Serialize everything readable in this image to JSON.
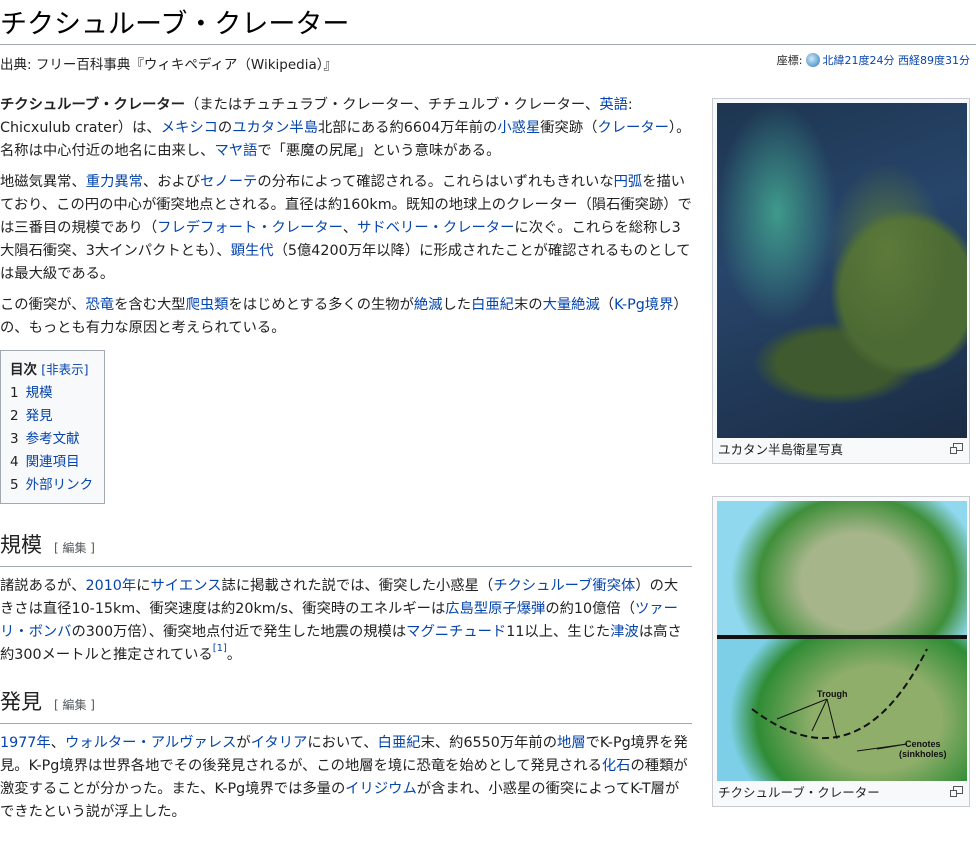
{
  "title": "チクシュルーブ・クレーター",
  "subtitle": "出典: フリー百科事典『ウィキペディア（Wikipedia）』",
  "coord": {
    "label": "座標:",
    "value": "北緯21度24分 西経89度31分"
  },
  "intro": [
    [
      [
        "チクシュルーブ・クレーター",
        "b"
      ],
      [
        "（またはチュチュラブ・クレーター、チチュルブ・クレーター、",
        0
      ],
      [
        "英語",
        1
      ],
      [
        ": Chicxulub crater）は、",
        0
      ],
      [
        "メキシコ",
        1
      ],
      [
        "の",
        0
      ],
      [
        "ユカタン半島",
        1
      ],
      [
        "北部にある約6604万年前の",
        0
      ],
      [
        "小惑星",
        1
      ],
      [
        "衝突跡（",
        0
      ],
      [
        "クレーター",
        1
      ],
      [
        "）。名称は中心付近の地名に由来し、",
        0
      ],
      [
        "マヤ語",
        1
      ],
      [
        "で「悪魔の尻尾」という意味がある。",
        0
      ]
    ],
    [
      [
        "地磁気異常、",
        0
      ],
      [
        "重力異常",
        1
      ],
      [
        "、および",
        0
      ],
      [
        "セノーテ",
        1
      ],
      [
        "の分布によって確認される。これらはいずれもきれいな",
        0
      ],
      [
        "円弧",
        1
      ],
      [
        "を描いており、この円の中心が衝突地点とされる。直径は約160km。既知の地球上のクレーター（隕石衝突跡）では三番目の規模であり（",
        0
      ],
      [
        "フレデフォート・クレーター",
        1
      ],
      [
        "、",
        0
      ],
      [
        "サドベリー・クレーター",
        1
      ],
      [
        "に次ぐ。これらを総称し3大隕石衝突、3大インパクトとも）、",
        0
      ],
      [
        "顕生代",
        1
      ],
      [
        "（5億4200万年以降）に形成されたことが確認されるものとしては最大級である。",
        0
      ]
    ],
    [
      [
        "この衝突が、",
        0
      ],
      [
        "恐竜",
        1
      ],
      [
        "を含む大型",
        0
      ],
      [
        "爬虫類",
        1
      ],
      [
        "をはじめとする多くの生物が",
        0
      ],
      [
        "絶滅",
        1
      ],
      [
        "した",
        0
      ],
      [
        "白亜紀",
        1
      ],
      [
        "末の",
        0
      ],
      [
        "大量絶滅",
        1
      ],
      [
        "（",
        0
      ],
      [
        "K-Pg境界",
        1
      ],
      [
        "）の、もっとも有力な原因と考えられている。",
        0
      ]
    ]
  ],
  "toc": {
    "title": "目次",
    "hide": "[非表示]",
    "items": [
      {
        "num": "1",
        "label": "規模"
      },
      {
        "num": "2",
        "label": "発見"
      },
      {
        "num": "3",
        "label": "参考文献"
      },
      {
        "num": "4",
        "label": "関連項目"
      },
      {
        "num": "5",
        "label": "外部リンク"
      }
    ]
  },
  "sections": [
    {
      "heading": "規模",
      "edit": "[ 編集 ]",
      "paras": [
        [
          [
            "諸説あるが、",
            0
          ],
          [
            "2010年",
            1
          ],
          [
            "に",
            0
          ],
          [
            "サイエンス",
            1
          ],
          [
            "誌に掲載された説では、衝突した小惑星（",
            0
          ],
          [
            "チクシュルーブ衝突体",
            1
          ],
          [
            "）の大きさは直径10-15km、衝突速度は約20km/s、衝突時のエネルギーは",
            0
          ],
          [
            "広島型原子爆弾",
            1
          ],
          [
            "の約10億倍（",
            0
          ],
          [
            "ツァーリ・ボンバ",
            1
          ],
          [
            "の300万倍）、衝突地点付近で発生した地震の規模は",
            0
          ],
          [
            "マグニチュード",
            1
          ],
          [
            "11以上、生じた",
            0
          ],
          [
            "津波",
            1
          ],
          [
            "は高さ約300メートルと推定されている",
            0
          ],
          [
            "[1]",
            "sup"
          ],
          [
            "。",
            0
          ]
        ]
      ]
    },
    {
      "heading": "発見",
      "edit": "[ 編集 ]",
      "paras": [
        [
          [
            "1977年",
            1
          ],
          [
            "、",
            0
          ],
          [
            "ウォルター・アルヴァレス",
            1
          ],
          [
            "が",
            0
          ],
          [
            "イタリア",
            1
          ],
          [
            "において、",
            0
          ],
          [
            "白亜紀",
            1
          ],
          [
            "末、約6550万年前の",
            0
          ],
          [
            "地層",
            1
          ],
          [
            "でK-Pg境界を発見。K-Pg境界は世界各地でその後発見されるが、この地層を境に恐竜を始めとして発見される",
            0
          ],
          [
            "化石",
            1
          ],
          [
            "の種類が激変することが分かった。また、K-Pg境界では多量の",
            0
          ],
          [
            "イリジウム",
            1
          ],
          [
            "が含まれ、小惑星の衝突によってK-T層ができたという説が浮上した。",
            0
          ]
        ]
      ]
    }
  ],
  "figures": [
    {
      "caption": "ユカタン半島衛星写真"
    },
    {
      "caption": "チクシュルーブ・クレーター",
      "labels": {
        "trough": "Trough",
        "cenotes": "Cenotes",
        "sinkholes": "(sinkholes)"
      }
    }
  ]
}
